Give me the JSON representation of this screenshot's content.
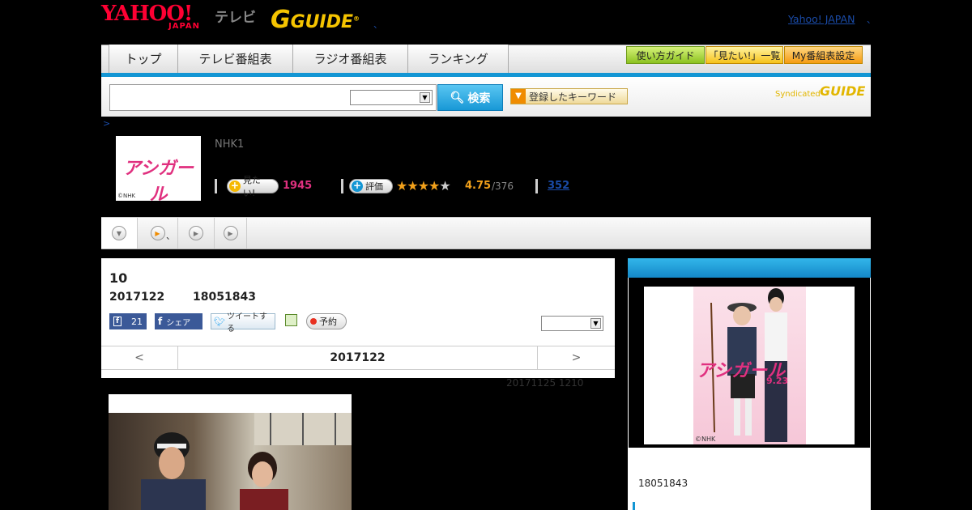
{
  "header": {
    "logo_yahoo": "YAHOO!",
    "logo_japan": "JAPAN",
    "logo_tv": "テレビ",
    "logo_gguide_g": "G",
    "logo_gguide_text": "GUIDE",
    "dot": "、",
    "yahoo_japan_link": "Yahoo! JAPAN",
    "dot2": "、"
  },
  "nav": {
    "tabs": [
      {
        "label": "トップ"
      },
      {
        "label": "テレビ番組表"
      },
      {
        "label": "ラジオ番組表"
      },
      {
        "label": "ランキング"
      }
    ],
    "guide_buttons": [
      {
        "label": "使い方ガイド"
      },
      {
        "label": "「見たい!」一覧"
      },
      {
        "label": "My番組表設定"
      }
    ]
  },
  "search": {
    "input_value": "",
    "select_value": "",
    "button_label": "検索",
    "keyword_button": "登録したキーワード",
    "syndicated": "Syndicated",
    "syndicated_logo": "GUIDE"
  },
  "breadcrumb": ">",
  "program": {
    "thumb_title": "アシガール",
    "thumb_copyright": "©NHK",
    "channel": "NHK1",
    "mitai_label": "見たい!",
    "mitai_count": "1945",
    "rate_label": "評価",
    "stars": "★★★★",
    "star_half": "★",
    "rating": "4.75",
    "rating_total": "/376",
    "reviews": "352"
  },
  "tabs": {
    "dot": "、"
  },
  "episode": {
    "number": "10",
    "date": "2017122",
    "time": "18051843",
    "fb_count": "21",
    "fb_share": "シェア",
    "tweet": "ツイートする",
    "reserve": "予約",
    "select_value": "",
    "prev": "<",
    "next": ">",
    "pager_date": "2017122",
    "updated": "20171125  1210"
  },
  "side": {
    "poster_title": "アシガール",
    "poster_date": "9.23",
    "poster_copyright": "©NHK",
    "time": "18051843"
  },
  "colors": {
    "accent_blue": "#1396d4",
    "brand_red": "#ff0033",
    "pink": "#e0307f",
    "gold": "#f5c400"
  }
}
